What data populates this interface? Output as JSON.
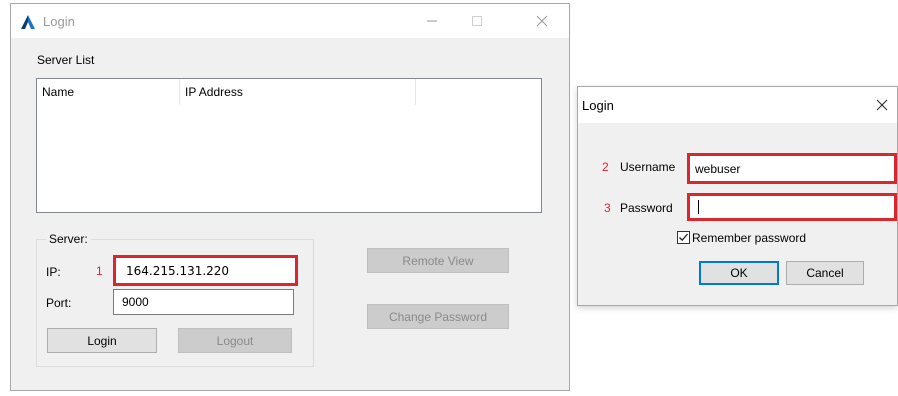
{
  "main_window": {
    "title": "Login",
    "server_list_label": "Server List",
    "columns": [
      "Name",
      "IP Address"
    ],
    "server_group_label": "Server:",
    "ip_label": "IP:",
    "ip_step": "1",
    "ip_value": "164.215.131.220",
    "port_label": "Port:",
    "port_value": "9000",
    "login_button": "Login",
    "logout_button": "Logout",
    "remote_view_button": "Remote View",
    "change_password_button": "Change Password"
  },
  "dialog": {
    "title": "Login",
    "username_step": "2",
    "username_label": "Username",
    "username_value": "webuser",
    "password_step": "3",
    "password_label": "Password",
    "remember_label": "Remember password",
    "remember_checked": true,
    "ok_button": "OK",
    "cancel_button": "Cancel"
  },
  "colors": {
    "highlight_red": "#d9272e",
    "accent_blue": "#0078d7"
  }
}
